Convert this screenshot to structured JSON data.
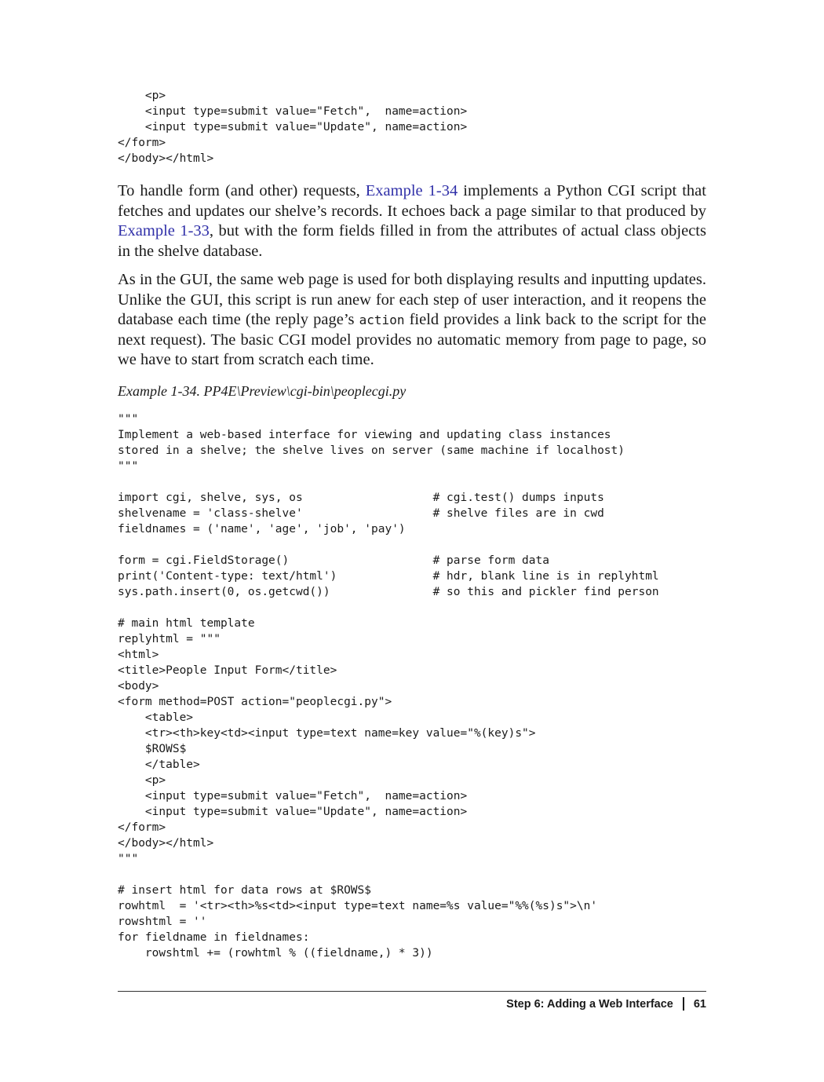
{
  "code_top": "    <p>\n    <input type=submit value=\"Fetch\",  name=action>\n    <input type=submit value=\"Update\", name=action>\n</form>\n</body></html>",
  "para1": {
    "t1": "To handle form (and other) requests, ",
    "link1": "Example 1-34",
    "t2": " implements a Python CGI script that fetches and updates our shelve’s records. It echoes back a page similar to that produced by ",
    "link2": "Example 1-33",
    "t3": ", but with the form fields filled in from the attributes of actual class objects in the shelve database."
  },
  "para2": {
    "t1": "As in the GUI, the same web page is used for both displaying results and inputting updates. Unlike the GUI, this script is run anew for each step of user interaction, and it reopens the database each time (the reply page’s ",
    "code": "action",
    "t2": " field provides a link back to the script for the next request). The basic CGI model provides no automatic memory from page to page, so we have to start from scratch each time."
  },
  "caption": "Example 1-34. PP4E\\Preview\\cgi-bin\\peoplecgi.py",
  "code_main": "\"\"\"\nImplement a web-based interface for viewing and updating class instances\nstored in a shelve; the shelve lives on server (same machine if localhost)\n\"\"\"\n\nimport cgi, shelve, sys, os                   # cgi.test() dumps inputs\nshelvename = 'class-shelve'                   # shelve files are in cwd\nfieldnames = ('name', 'age', 'job', 'pay')\n\nform = cgi.FieldStorage()                     # parse form data\nprint('Content-type: text/html')              # hdr, blank line is in replyhtml\nsys.path.insert(0, os.getcwd())               # so this and pickler find person\n\n# main html template\nreplyhtml = \"\"\"\n<html>\n<title>People Input Form</title>\n<body>\n<form method=POST action=\"peoplecgi.py\">\n    <table>\n    <tr><th>key<td><input type=text name=key value=\"%(key)s\">\n    $ROWS$\n    </table>\n    <p>\n    <input type=submit value=\"Fetch\",  name=action>\n    <input type=submit value=\"Update\", name=action>\n</form>\n</body></html>\n\"\"\"\n\n# insert html for data rows at $ROWS$\nrowhtml  = '<tr><th>%s<td><input type=text name=%s value=\"%%(%s)s\">\\n'\nrowshtml = ''\nfor fieldname in fieldnames:\n    rowshtml += (rowhtml % ((fieldname,) * 3))",
  "footer": {
    "section": "Step 6: Adding a Web Interface",
    "page": "61"
  }
}
